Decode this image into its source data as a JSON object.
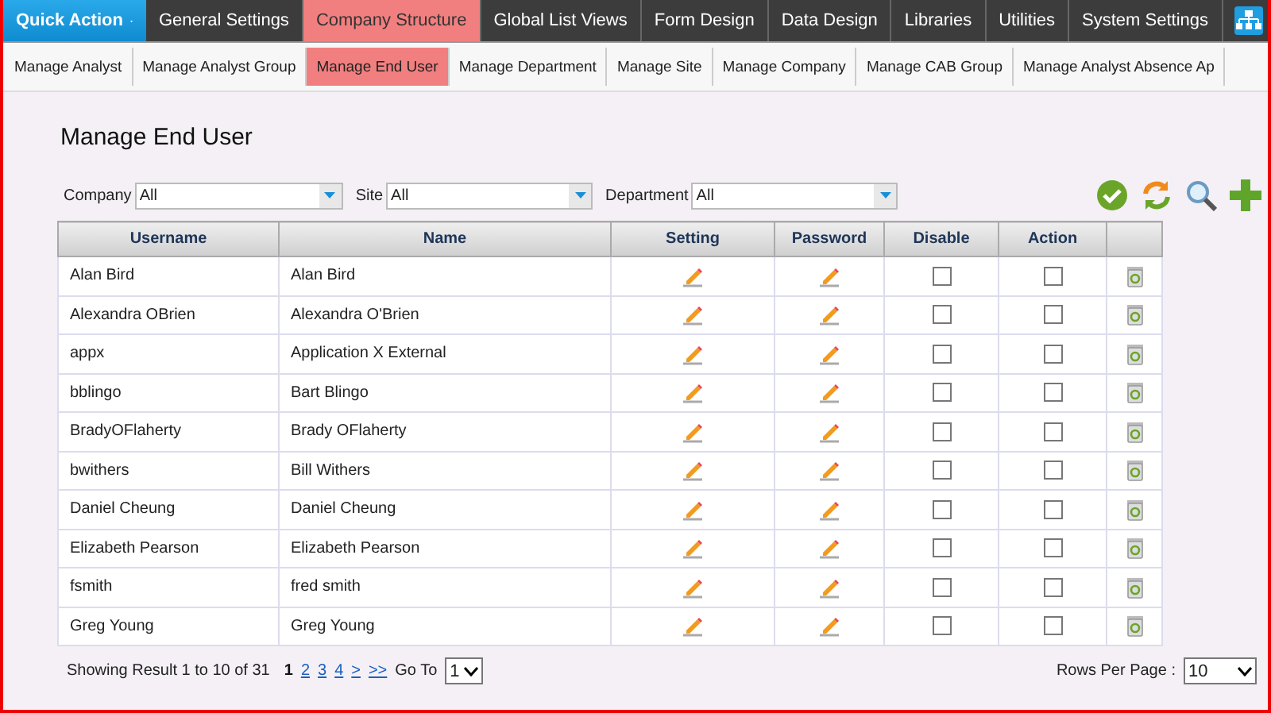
{
  "quick_action": {
    "label": "Quick Action"
  },
  "top_nav": [
    {
      "label": "General Settings",
      "selected": false
    },
    {
      "label": "Company Structure",
      "selected": true
    },
    {
      "label": "Global List Views",
      "selected": false
    },
    {
      "label": "Form Design",
      "selected": false
    },
    {
      "label": "Data Design",
      "selected": false
    },
    {
      "label": "Libraries",
      "selected": false
    },
    {
      "label": "Utilities",
      "selected": false
    },
    {
      "label": "System Settings",
      "selected": false
    }
  ],
  "sub_nav": [
    {
      "label": "Manage Analyst",
      "selected": false
    },
    {
      "label": "Manage Analyst Group",
      "selected": false
    },
    {
      "label": "Manage End User",
      "selected": true
    },
    {
      "label": "Manage Department",
      "selected": false
    },
    {
      "label": "Manage Site",
      "selected": false
    },
    {
      "label": "Manage Company",
      "selected": false
    },
    {
      "label": "Manage CAB Group",
      "selected": false
    },
    {
      "label": "Manage Analyst Absence Ap",
      "selected": false
    }
  ],
  "page_title": "Manage End User",
  "filters": [
    {
      "label": "Company",
      "value": "All"
    },
    {
      "label": "Site",
      "value": "All"
    },
    {
      "label": "Department",
      "value": "All"
    }
  ],
  "table": {
    "columns": [
      "Username",
      "Name",
      "Setting",
      "Password",
      "Disable",
      "Action"
    ],
    "rows": [
      {
        "username": "Alan Bird",
        "name": "Alan Bird",
        "disable": false,
        "action": false
      },
      {
        "username": "Alexandra OBrien",
        "name": "Alexandra O'Brien",
        "disable": false,
        "action": false
      },
      {
        "username": "appx",
        "name": "Application X External",
        "disable": false,
        "action": false
      },
      {
        "username": "bblingo",
        "name": "Bart Blingo",
        "disable": false,
        "action": false
      },
      {
        "username": "BradyOFlaherty",
        "name": "Brady OFlaherty",
        "disable": false,
        "action": false
      },
      {
        "username": "bwithers",
        "name": "Bill Withers",
        "disable": false,
        "action": false
      },
      {
        "username": "Daniel Cheung",
        "name": "Daniel Cheung",
        "disable": false,
        "action": false
      },
      {
        "username": "Elizabeth Pearson",
        "name": "Elizabeth Pearson",
        "disable": false,
        "action": false
      },
      {
        "username": "fsmith",
        "name": "fred smith",
        "disable": false,
        "action": false
      },
      {
        "username": "Greg Young",
        "name": "Greg Young",
        "disable": false,
        "action": false
      }
    ]
  },
  "pagination": {
    "summary": "Showing Result 1 to 10 of 31",
    "pages": [
      {
        "label": "1",
        "selected": true
      },
      {
        "label": "2",
        "selected": false
      },
      {
        "label": "3",
        "selected": false
      },
      {
        "label": "4",
        "selected": false
      },
      {
        "label": ">",
        "selected": false
      },
      {
        "label": ">>",
        "selected": false
      }
    ],
    "goto_label": "Go To",
    "goto_value": "1",
    "rows_per_page_label": "Rows Per Page :",
    "rows_per_page_value": "10"
  }
}
